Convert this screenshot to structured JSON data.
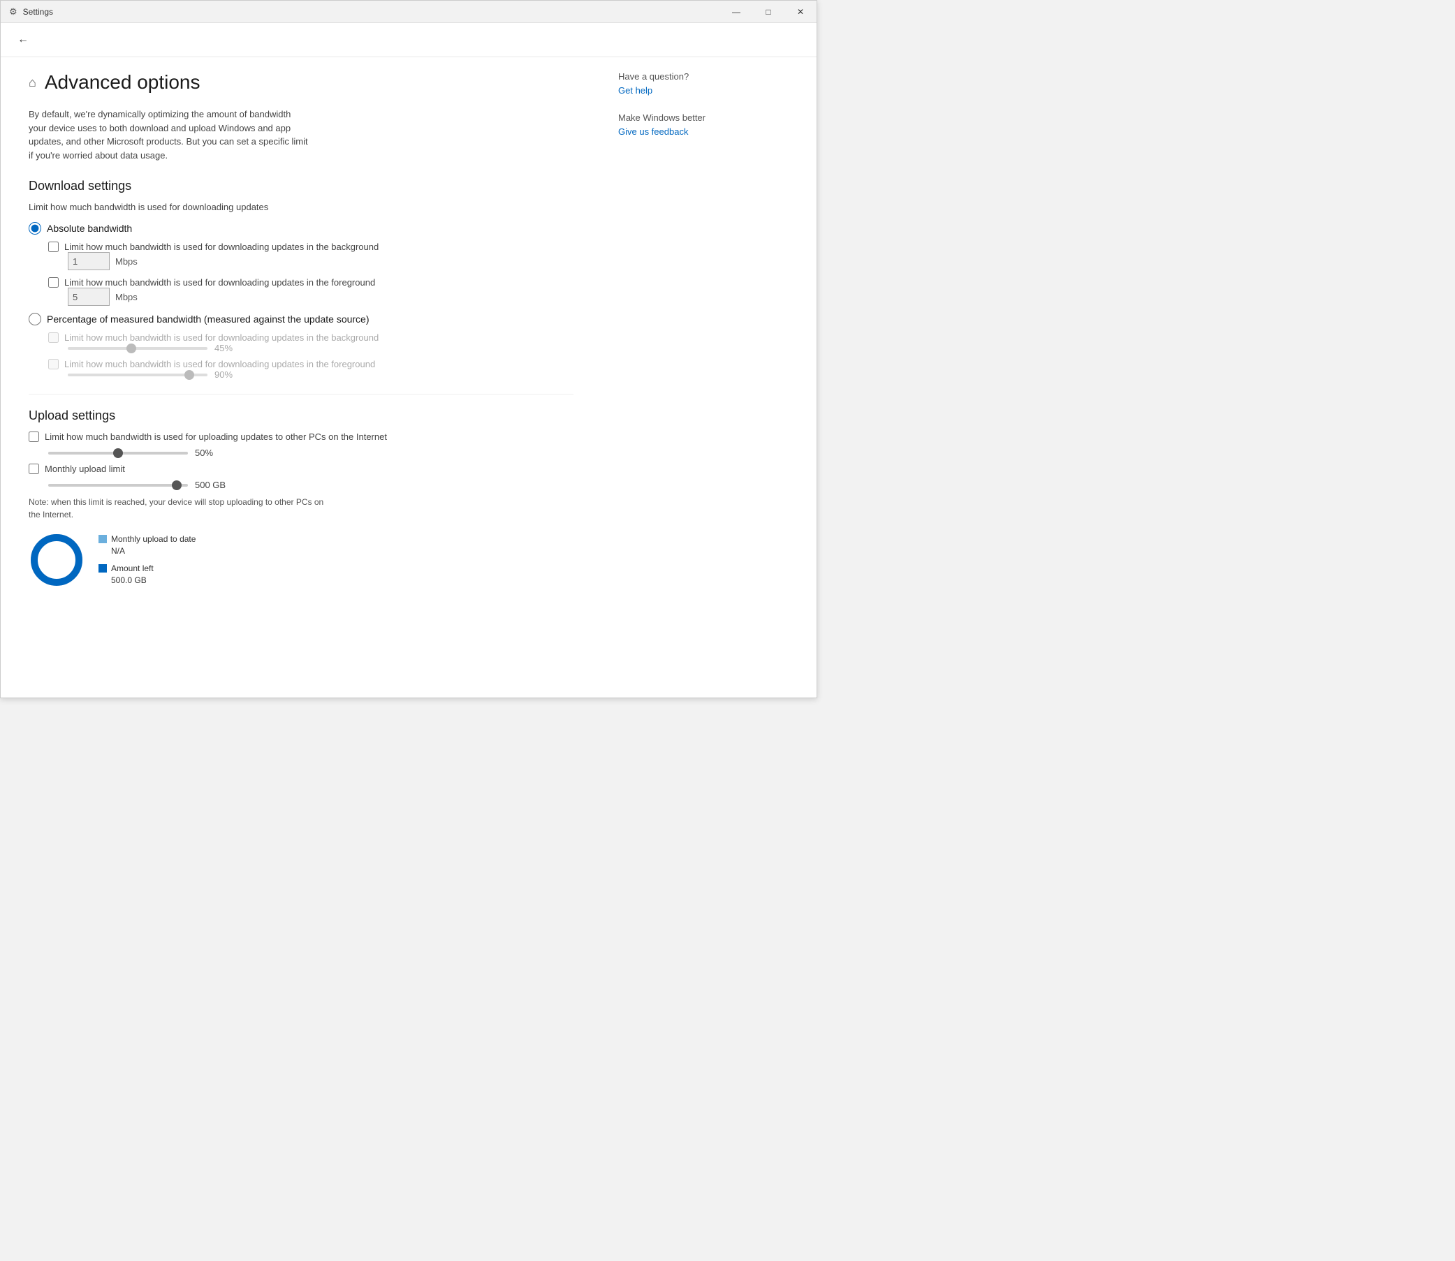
{
  "window": {
    "titlebar": {
      "title": "Settings",
      "minimize": "—",
      "maximize": "□",
      "close": "✕"
    }
  },
  "nav": {
    "back_label": "←"
  },
  "page": {
    "home_icon": "⌂",
    "title": "Advanced options",
    "description": "By default, we're dynamically optimizing the amount of bandwidth your device uses to both download and upload Windows and app updates, and other Microsoft products. But you can set a specific limit if you're worried about data usage."
  },
  "download_settings": {
    "section_title": "Download settings",
    "sub_label": "Limit how much bandwidth is used for downloading updates",
    "radio_absolute": "Absolute bandwidth",
    "radio_absolute_selected": true,
    "bg_checkbox_label": "Limit how much bandwidth is used for downloading updates in the background",
    "bg_value": "1",
    "bg_unit": "Mbps",
    "fg_checkbox_label": "Limit how much bandwidth is used for downloading updates in the foreground",
    "fg_value": "5",
    "fg_unit": "Mbps",
    "radio_percentage": "Percentage of measured bandwidth (measured against the update source)",
    "radio_percentage_selected": false,
    "pct_bg_label": "Limit how much bandwidth is used for downloading updates in the background",
    "pct_bg_value": 45,
    "pct_bg_display": "45%",
    "pct_fg_label": "Limit how much bandwidth is used for downloading updates in the foreground",
    "pct_fg_value": 90,
    "pct_fg_display": "90%"
  },
  "upload_settings": {
    "section_title": "Upload settings",
    "checkbox_label": "Limit how much bandwidth is used for uploading updates to other PCs on the Internet",
    "upload_value": 50,
    "upload_display": "50%",
    "monthly_checkbox_label": "Monthly upload limit",
    "monthly_value": 95,
    "monthly_display": "500 GB",
    "note": "Note: when this limit is reached, your device will stop uploading to other PCs on the Internet."
  },
  "chart": {
    "monthly_upload_label": "Monthly upload to date",
    "monthly_upload_value": "N/A",
    "amount_left_label": "Amount left",
    "amount_left_value": "500.0 GB",
    "circle_stroke": "#0067c0",
    "circle_bg": "#e0e0e0"
  },
  "sidebar": {
    "question_heading": "Have a question?",
    "get_help": "Get help",
    "make_better_heading": "Make Windows better",
    "feedback_label": "Give us feedback"
  }
}
